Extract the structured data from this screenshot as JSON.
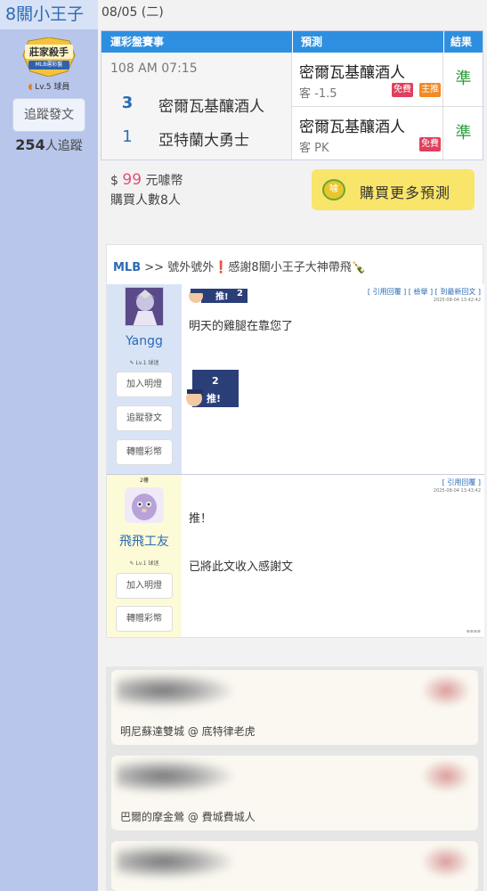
{
  "sidebar": {
    "username": "8關小王子",
    "badge": {
      "line1": "莊家殺手",
      "line2": "MLB運彩盤"
    },
    "level": "Lv.5 球員",
    "follow_button": "追蹤發文",
    "follower_count": "254",
    "follower_suffix": "人追蹤"
  },
  "main": {
    "date": "08/05 (二)",
    "table": {
      "headers": {
        "game": "運彩盤賽事",
        "prediction": "預測",
        "result": "結果"
      },
      "game_time": "108 AM 07:15",
      "teams": [
        {
          "score": "3",
          "name": "密爾瓦基釀酒人"
        },
        {
          "score": "1",
          "name": "亞特蘭大勇士"
        }
      ],
      "picks": [
        {
          "team": "密爾瓦基釀酒人",
          "line": "客 -1.5",
          "tags": [
            "免費",
            "主推"
          ],
          "result": "準"
        },
        {
          "team": "密爾瓦基釀酒人",
          "line": "客 PK",
          "tags": [
            "免費"
          ],
          "result": "準"
        }
      ]
    },
    "price": {
      "prefix": "$",
      "amount": "99",
      "suffix": "元噱幣"
    },
    "buyers": "購買人數8人",
    "buy_button": {
      "label": "購買更多預測",
      "coin": "噱"
    }
  },
  "thread": {
    "title": {
      "league": "MLB",
      "sep": ">>",
      "text": "號外號外",
      "bang": "❗",
      "rest": "感謝8關小王子大神帶飛🍾"
    },
    "posts": [
      {
        "name": "Yangg",
        "level": "Lv.1 球迷",
        "buttons": [
          "加入明燈",
          "追蹤發文",
          "轉贈彩幣"
        ],
        "like_count": "2",
        "like_label": "推!",
        "links": "[ 引用回覆 ]  [ 檢舉 ]  [ 到最新回文 ]",
        "time": "2025-08-04 13:42:42",
        "lines": [
          "明天的雞腿在靠您了"
        ]
      },
      {
        "floor": "2樓",
        "name": "飛飛工友",
        "level": "Lv.1 球迷",
        "buttons": [
          "加入明燈",
          "轉贈彩幣"
        ],
        "links": "[ 引用回覆 ]",
        "time": "2025-08-04 13:43:42",
        "lines": [
          "推！",
          "已將此文收入感謝文"
        ]
      }
    ]
  },
  "comments": [
    {
      "text": "明尼蘇達雙城 @ 底特律老虎"
    },
    {
      "text": "巴爾的摩金鶯 @ 費城費城人"
    },
    {
      "text": ""
    }
  ],
  "colors": {
    "accent_blue": "#2e8fe0",
    "sidebar_bg": "#b7c6ea",
    "result_green": "#2a9d3a",
    "price_pink": "#e0507a",
    "buy_yellow": "#f9e56a"
  },
  "icons": [
    "pencil-icon",
    "cap-icon",
    "thumb-up-icon",
    "coin-icon",
    "bottle-icon"
  ]
}
